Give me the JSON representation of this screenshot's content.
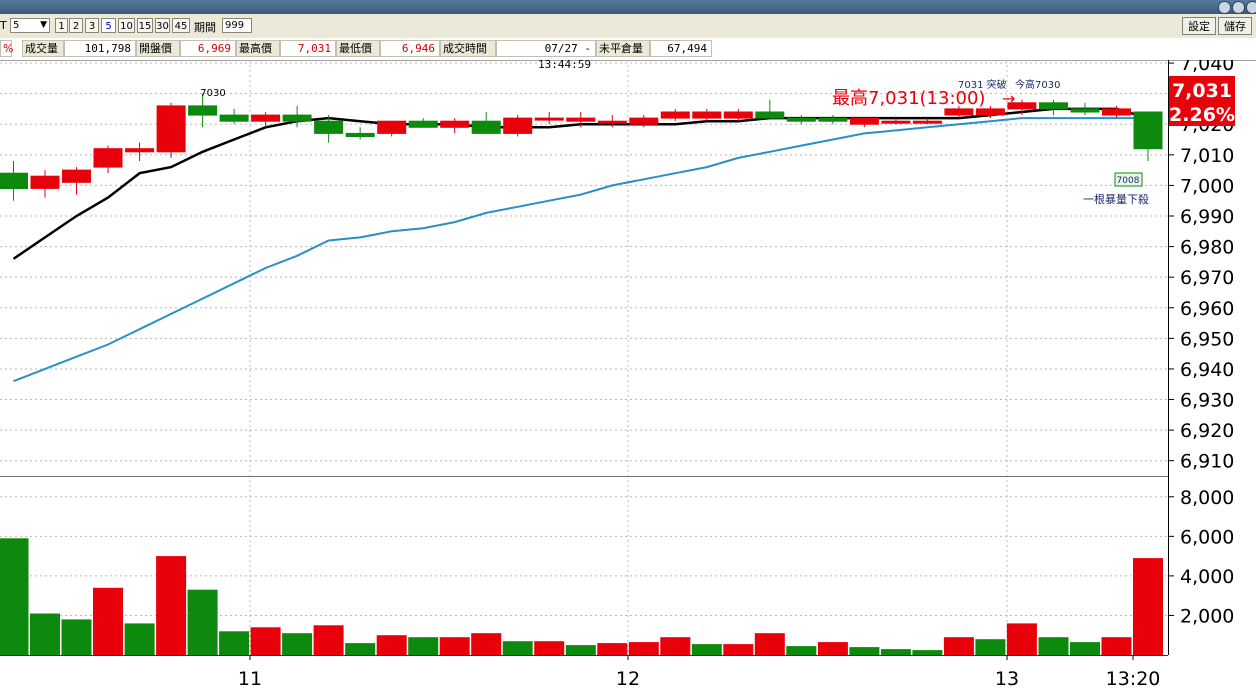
{
  "toolbar": {
    "left_stub": "T",
    "period_select": "5",
    "intervals": [
      "1",
      "2",
      "3",
      "5",
      "10",
      "15",
      "30",
      "45"
    ],
    "selected_interval": "5",
    "period_label": "期間",
    "period_value": "999",
    "settings_button": "設定",
    "save_button": "儲存"
  },
  "quote": {
    "pct_stub": "%",
    "volume_label": "成交量",
    "volume": "101,798",
    "open_label": "開盤價",
    "open": "6,969",
    "high_label": "最高價",
    "high": "7,031",
    "low_label": "最低價",
    "low": "6,946",
    "time_label": "成交時間",
    "time": "07/27 - 13:44:59",
    "oi_label": "未平倉量",
    "oi": "67,494"
  },
  "colors": {
    "up": "#e8000b",
    "down": "#0d8a0d",
    "ma_short": "#000000",
    "ma_long": "#2a8fc8",
    "price_tag_bg": "#e8000b",
    "grid": "#b8b8b8"
  },
  "annotations": {
    "high_marker": "最高7,031(13:00)",
    "high_arrow": "→",
    "label_7030": "7030",
    "breakout": "7031 突破",
    "today_high": "今高7030",
    "low_box": "7008",
    "big_volume_drop": "一根暴量下殺",
    "last_price": "7,031",
    "last_change": "2.26%"
  },
  "chart_data": [
    {
      "type": "candlestick",
      "title": "",
      "x_ticks": [
        "11",
        "12",
        "13",
        "13:20"
      ],
      "y_ticks": [
        "6,910",
        "6,920",
        "6,930",
        "6,940",
        "6,950",
        "6,960",
        "6,970",
        "6,980",
        "6,990",
        "7,000",
        "7,010",
        "7,020",
        "7,030",
        "7,040"
      ],
      "ylim": [
        6905,
        7041
      ],
      "grid": true,
      "candles": [
        {
          "o": 7004,
          "h": 7008,
          "l": 6995,
          "c": 6999
        },
        {
          "o": 6999,
          "h": 7005,
          "l": 6996,
          "c": 7003
        },
        {
          "o": 7001,
          "h": 7006,
          "l": 6997,
          "c": 7005
        },
        {
          "o": 7006,
          "h": 7013,
          "l": 7004,
          "c": 7012
        },
        {
          "o": 7011,
          "h": 7014,
          "l": 7008,
          "c": 7012
        },
        {
          "o": 7011,
          "h": 7027,
          "l": 7009,
          "c": 7026
        },
        {
          "o": 7026,
          "h": 7030,
          "l": 7019,
          "c": 7023
        },
        {
          "o": 7023,
          "h": 7025,
          "l": 7020,
          "c": 7021
        },
        {
          "o": 7021,
          "h": 7024,
          "l": 7019,
          "c": 7023
        },
        {
          "o": 7023,
          "h": 7026,
          "l": 7019,
          "c": 7021
        },
        {
          "o": 7021,
          "h": 7023,
          "l": 7014,
          "c": 7017
        },
        {
          "o": 7017,
          "h": 7019,
          "l": 7015,
          "c": 7016
        },
        {
          "o": 7017,
          "h": 7021,
          "l": 7016,
          "c": 7021
        },
        {
          "o": 7021,
          "h": 7022,
          "l": 7019,
          "c": 7019
        },
        {
          "o": 7019,
          "h": 7022,
          "l": 7017,
          "c": 7021
        },
        {
          "o": 7021,
          "h": 7024,
          "l": 7017,
          "c": 7017
        },
        {
          "o": 7017,
          "h": 7023,
          "l": 7016,
          "c": 7022
        },
        {
          "o": 7022,
          "h": 7024,
          "l": 7020,
          "c": 7022
        },
        {
          "o": 7021,
          "h": 7024,
          "l": 7019,
          "c": 7022
        },
        {
          "o": 7021,
          "h": 7023,
          "l": 7019,
          "c": 7021
        },
        {
          "o": 7020,
          "h": 7023,
          "l": 7019,
          "c": 7022
        },
        {
          "o": 7022,
          "h": 7025,
          "l": 7021,
          "c": 7024
        },
        {
          "o": 7022,
          "h": 7025,
          "l": 7021,
          "c": 7024
        },
        {
          "o": 7022,
          "h": 7025,
          "l": 7021,
          "c": 7024
        },
        {
          "o": 7024,
          "h": 7028,
          "l": 7022,
          "c": 7022
        },
        {
          "o": 7022,
          "h": 7023,
          "l": 7020,
          "c": 7021
        },
        {
          "o": 7022,
          "h": 7023,
          "l": 7020,
          "c": 7021
        },
        {
          "o": 7020,
          "h": 7022,
          "l": 7019,
          "c": 7022
        },
        {
          "o": 7021,
          "h": 7022,
          "l": 7020,
          "c": 7021
        },
        {
          "o": 7021,
          "h": 7022,
          "l": 7020,
          "c": 7021
        },
        {
          "o": 7023,
          "h": 7026,
          "l": 7022,
          "c": 7025
        },
        {
          "o": 7023,
          "h": 7026,
          "l": 7022,
          "c": 7025
        },
        {
          "o": 7025,
          "h": 7028,
          "l": 7023,
          "c": 7027
        },
        {
          "o": 7027,
          "h": 7028,
          "l": 7023,
          "c": 7025
        },
        {
          "o": 7025,
          "h": 7027,
          "l": 7023,
          "c": 7024
        },
        {
          "o": 7023,
          "h": 7026,
          "l": 7022,
          "c": 7025
        },
        {
          "o": 7024,
          "h": 7024,
          "l": 7008,
          "c": 7012
        }
      ],
      "ma_short": [
        6976,
        6983,
        6990,
        6996,
        7004,
        7006,
        7011,
        7015,
        7019,
        7021,
        7022,
        7021,
        7020,
        7020,
        7020,
        7019,
        7019,
        7019,
        7020,
        7020,
        7020,
        7020,
        7021,
        7021,
        7022,
        7022,
        7022,
        7022,
        7022,
        7022,
        7022,
        7023,
        7024,
        7025,
        7025,
        7025,
        7022
      ],
      "ma_long": [
        6936,
        6940,
        6944,
        6948,
        6953,
        6958,
        6963,
        6968,
        6973,
        6977,
        6982,
        6983,
        6985,
        6986,
        6988,
        6991,
        6993,
        6995,
        6997,
        7000,
        7002,
        7004,
        7006,
        7009,
        7011,
        7013,
        7015,
        7017,
        7018,
        7019,
        7020,
        7021,
        7022,
        7022,
        7022,
        7022,
        7022
      ]
    },
    {
      "type": "bar",
      "title": "",
      "y_ticks": [
        "2,000",
        "4,000",
        "6,000",
        "8,000"
      ],
      "ylim": [
        0,
        9000
      ],
      "grid": true,
      "values": [
        5900,
        2100,
        1800,
        3400,
        1600,
        5000,
        3300,
        1200,
        1400,
        1100,
        1500,
        600,
        1000,
        900,
        900,
        1100,
        700,
        700,
        500,
        600,
        650,
        900,
        550,
        550,
        1100,
        450,
        650,
        400,
        300,
        250,
        900,
        800,
        1600,
        900,
        650,
        900,
        4900
      ],
      "colors": [
        "down",
        "down",
        "down",
        "up",
        "down",
        "up",
        "down",
        "down",
        "up",
        "down",
        "up",
        "down",
        "up",
        "down",
        "up",
        "up",
        "down",
        "up",
        "down",
        "up",
        "up",
        "up",
        "down",
        "up",
        "up",
        "down",
        "up",
        "down",
        "down",
        "down",
        "up",
        "down",
        "up",
        "down",
        "down",
        "up",
        "up"
      ]
    }
  ]
}
